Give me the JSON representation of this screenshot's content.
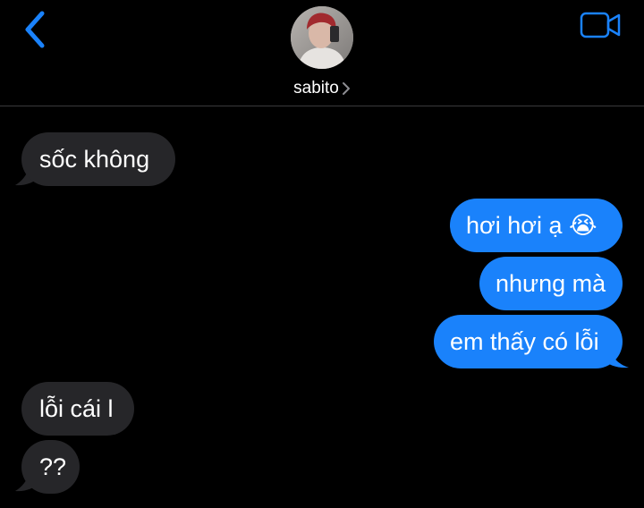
{
  "header": {
    "contact_name": "sabito",
    "back_icon": "chevron-left-icon",
    "video_icon": "video-camera-icon",
    "accent_color": "#1a82fb"
  },
  "messages": [
    {
      "direction": "received",
      "text": "sốc không"
    },
    {
      "direction": "sent",
      "text": "hơi hơi ạ",
      "emoji": "😭"
    },
    {
      "direction": "sent",
      "text": "nhưng mà"
    },
    {
      "direction": "sent",
      "text": "em thấy có lỗi"
    },
    {
      "direction": "received",
      "text": "lỗi cái l"
    },
    {
      "direction": "received",
      "text": "??"
    }
  ],
  "colors": {
    "sent_bubble": "#1a82fb",
    "received_bubble": "#262629",
    "background": "#000000"
  }
}
